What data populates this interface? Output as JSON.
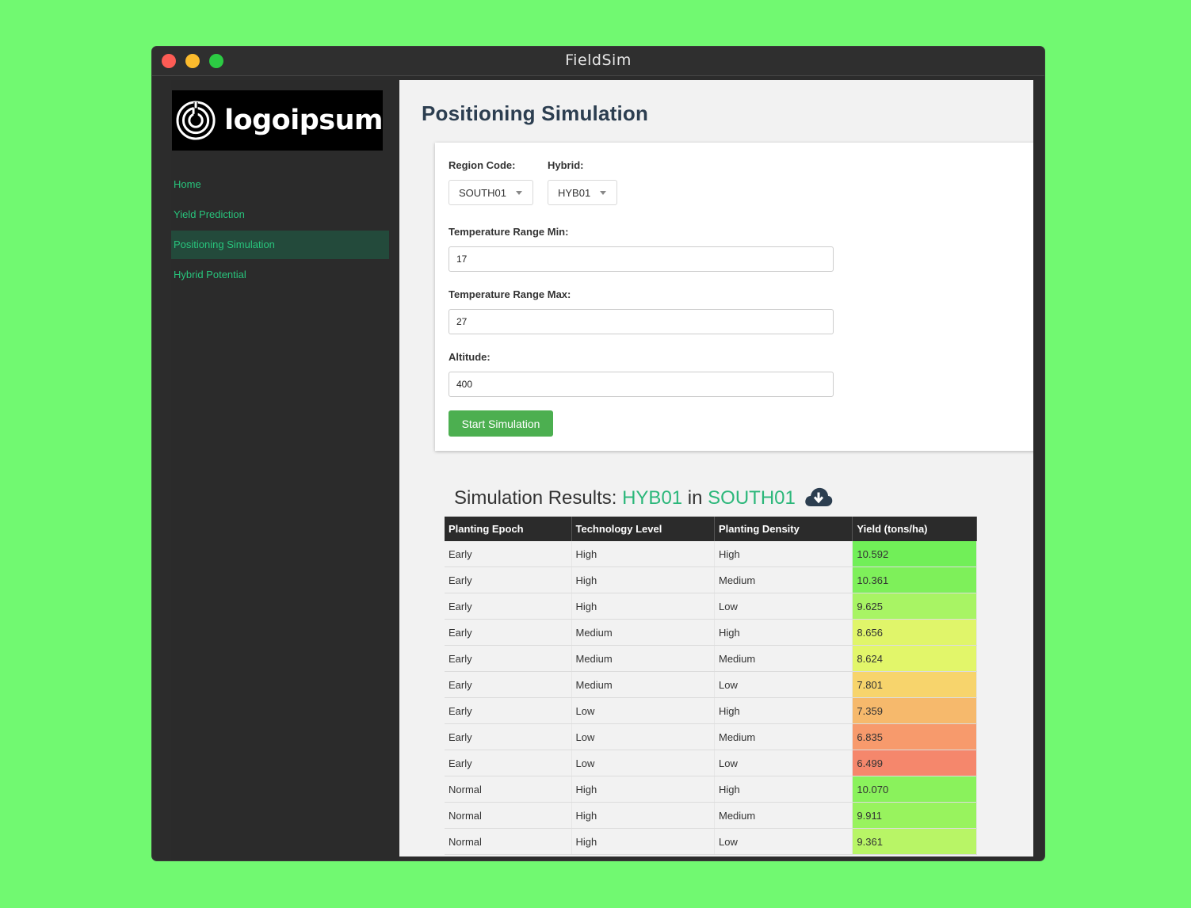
{
  "window": {
    "title": "FieldSim"
  },
  "sidebar": {
    "logo_text": "logoipsum",
    "items": [
      {
        "label": "Home",
        "active": false
      },
      {
        "label": "Yield Prediction",
        "active": false
      },
      {
        "label": "Positioning Simulation",
        "active": true
      },
      {
        "label": "Hybrid Potential",
        "active": false
      }
    ]
  },
  "main": {
    "title": "Positioning Simulation",
    "form": {
      "region_label": "Region Code:",
      "region_value": "SOUTH01",
      "hybrid_label": "Hybrid:",
      "hybrid_value": "HYB01",
      "temp_min_label": "Temperature Range Min:",
      "temp_min_value": "17",
      "temp_max_label": "Temperature Range Max:",
      "temp_max_value": "27",
      "altitude_label": "Altitude:",
      "altitude_value": "400",
      "start_button": "Start Simulation"
    },
    "results": {
      "prefix": "Simulation Results: ",
      "hybrid": "HYB01",
      "connector": " in ",
      "region": "SOUTH01",
      "download_icon": "cloud-download-icon",
      "columns": [
        "Planting Epoch",
        "Technology Level",
        "Planting Density",
        "Yield (tons/ha)"
      ],
      "rows": [
        {
          "epoch": "Early",
          "tech": "High",
          "density": "High",
          "yield": "10.592",
          "color": "#71ef58"
        },
        {
          "epoch": "Early",
          "tech": "High",
          "density": "Medium",
          "yield": "10.361",
          "color": "#7ef05a"
        },
        {
          "epoch": "Early",
          "tech": "High",
          "density": "Low",
          "yield": "9.625",
          "color": "#a8f464"
        },
        {
          "epoch": "Early",
          "tech": "Medium",
          "density": "High",
          "yield": "8.656",
          "color": "#e0f56a"
        },
        {
          "epoch": "Early",
          "tech": "Medium",
          "density": "Medium",
          "yield": "8.624",
          "color": "#e2f66a"
        },
        {
          "epoch": "Early",
          "tech": "Medium",
          "density": "Low",
          "yield": "7.801",
          "color": "#f7d46c"
        },
        {
          "epoch": "Early",
          "tech": "Low",
          "density": "High",
          "yield": "7.359",
          "color": "#f6b96c"
        },
        {
          "epoch": "Early",
          "tech": "Low",
          "density": "Medium",
          "yield": "6.835",
          "color": "#f79a6c"
        },
        {
          "epoch": "Early",
          "tech": "Low",
          "density": "Low",
          "yield": "6.499",
          "color": "#f5876c"
        },
        {
          "epoch": "Normal",
          "tech": "High",
          "density": "High",
          "yield": "10.070",
          "color": "#8af25c"
        },
        {
          "epoch": "Normal",
          "tech": "High",
          "density": "Medium",
          "yield": "9.911",
          "color": "#98f35e"
        },
        {
          "epoch": "Normal",
          "tech": "High",
          "density": "Low",
          "yield": "9.361",
          "color": "#b8f566"
        }
      ]
    }
  }
}
